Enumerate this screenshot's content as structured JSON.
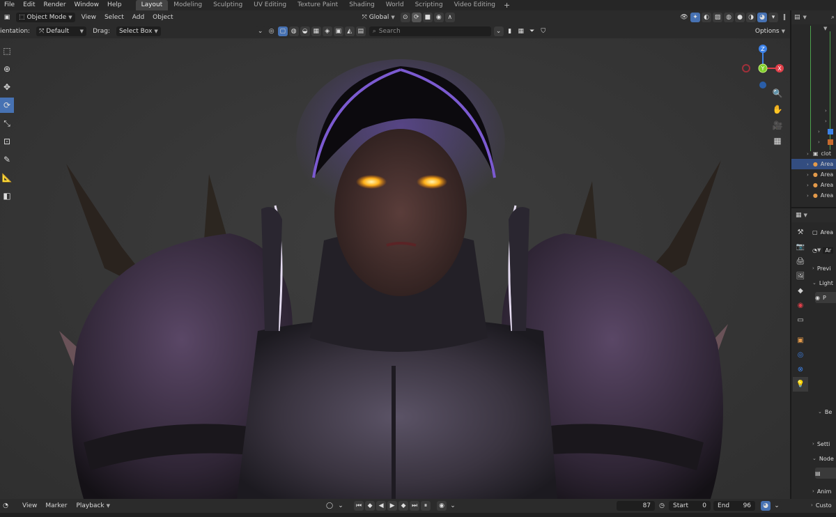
{
  "topbar": {
    "menus": [
      "File",
      "Edit",
      "Render",
      "Window",
      "Help"
    ],
    "workspaces": [
      {
        "label": "Layout",
        "active": true
      },
      {
        "label": "Modeling",
        "active": false
      },
      {
        "label": "Sculpting",
        "active": false
      },
      {
        "label": "UV Editing",
        "active": false
      },
      {
        "label": "Texture Paint",
        "active": false
      },
      {
        "label": "Shading",
        "active": false
      },
      {
        "label": "World",
        "active": false
      },
      {
        "label": "Scripting",
        "active": false
      },
      {
        "label": "Video Editing",
        "active": false
      }
    ],
    "add_tab": "+"
  },
  "header": {
    "mode": "Object Mode",
    "menus": [
      "View",
      "Select",
      "Add",
      "Object"
    ],
    "transform_orientation": "Global"
  },
  "toolsettings": {
    "orientation_label": "ientation:",
    "orientation_value": "Default",
    "drag_label": "Drag:",
    "drag_value": "Select Box",
    "search_placeholder": "Search",
    "options": "Options"
  },
  "gizmo": {
    "z": "Z",
    "y": "Y",
    "x": "X"
  },
  "outliner": {
    "rows": [
      {
        "label": "clot",
        "selected": false
      },
      {
        "label": "Area",
        "selected": true
      },
      {
        "label": "Area",
        "selected": false
      },
      {
        "label": "Area",
        "selected": false
      },
      {
        "label": "Area",
        "selected": false
      }
    ]
  },
  "properties": {
    "object_name": "Area",
    "data_name": "Ar",
    "panels": [
      "Previ",
      "Light",
      "P",
      "Be",
      "Setti",
      "Node",
      "Anim",
      "Custo"
    ]
  },
  "timeline": {
    "menus": [
      "View",
      "Marker",
      "Playback"
    ],
    "current_frame": "87",
    "start_label": "Start",
    "start_value": "0",
    "end_label": "End",
    "end_value": "96"
  },
  "colors": {
    "accent": "#4772b3",
    "selected_row": "#334d80",
    "axis_x": "#e0404a",
    "axis_y": "#7fcf2a",
    "axis_z": "#3d82e8"
  }
}
